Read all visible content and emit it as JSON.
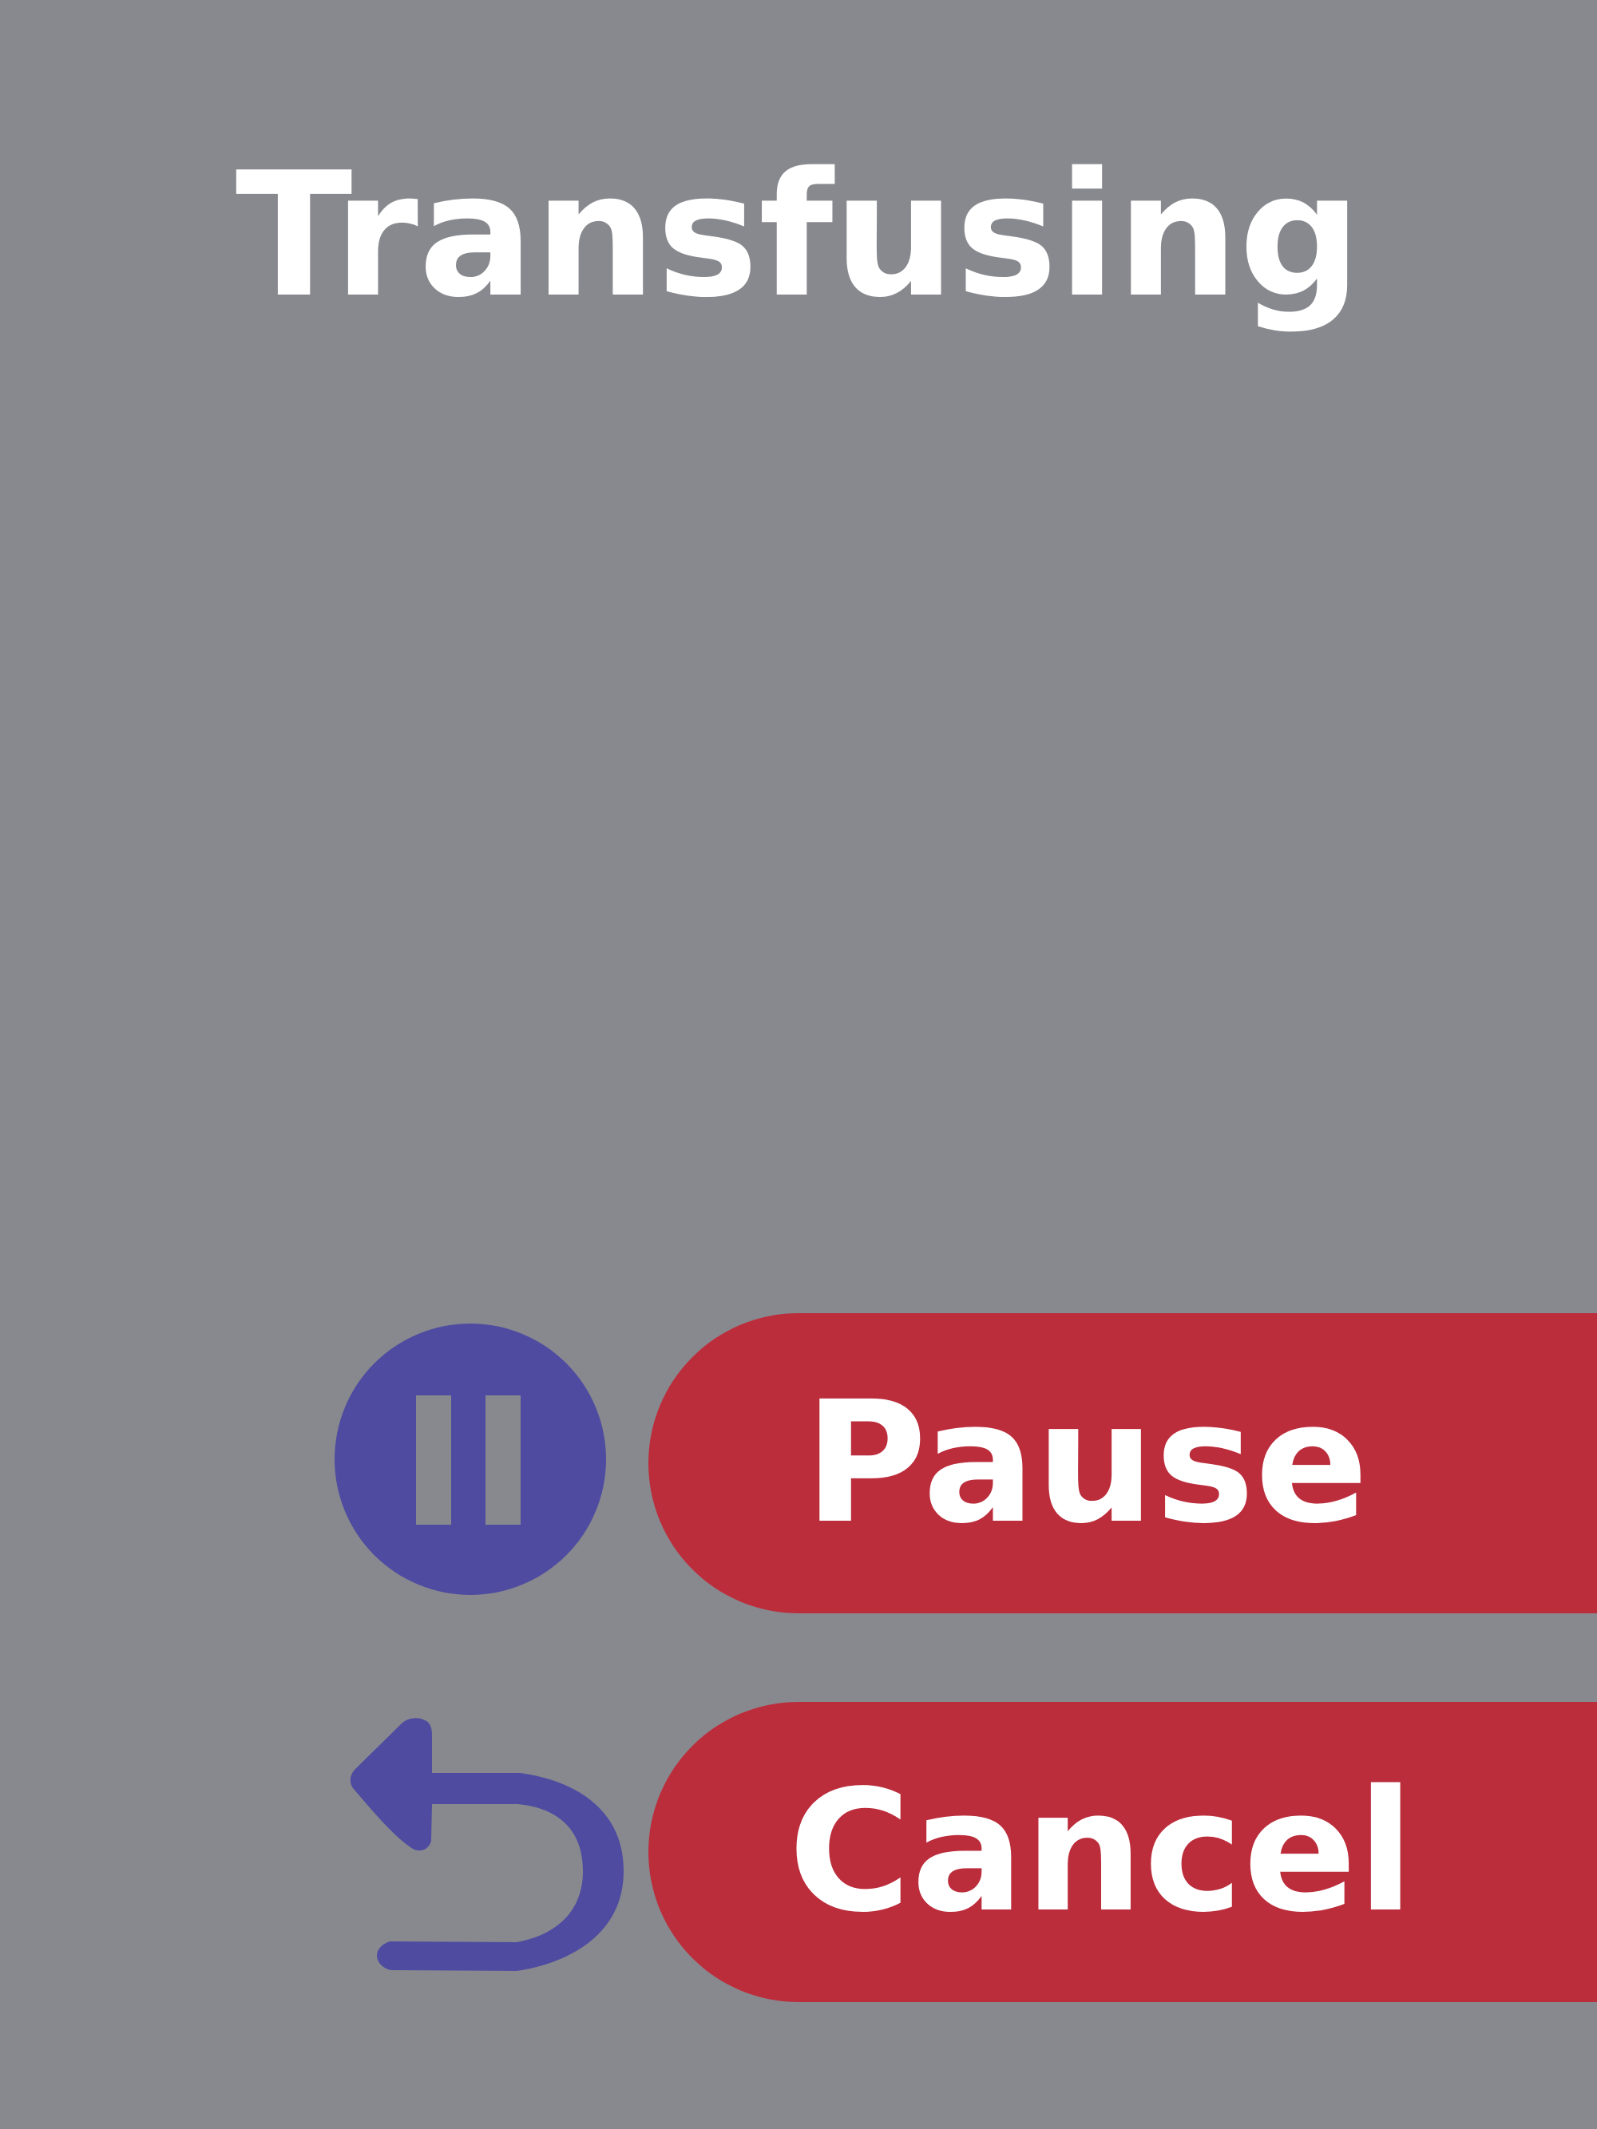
{
  "screen": {
    "title": "Transfusing"
  },
  "actions": {
    "pause_label": "Pause",
    "cancel_label": "Cancel"
  },
  "icons": {
    "pause": "pause-icon",
    "back": "back-arrow-icon"
  },
  "colors": {
    "background": "#88898e",
    "button": "#bc2d3c",
    "icon": "#4e4ba1",
    "text": "#ffffff"
  }
}
